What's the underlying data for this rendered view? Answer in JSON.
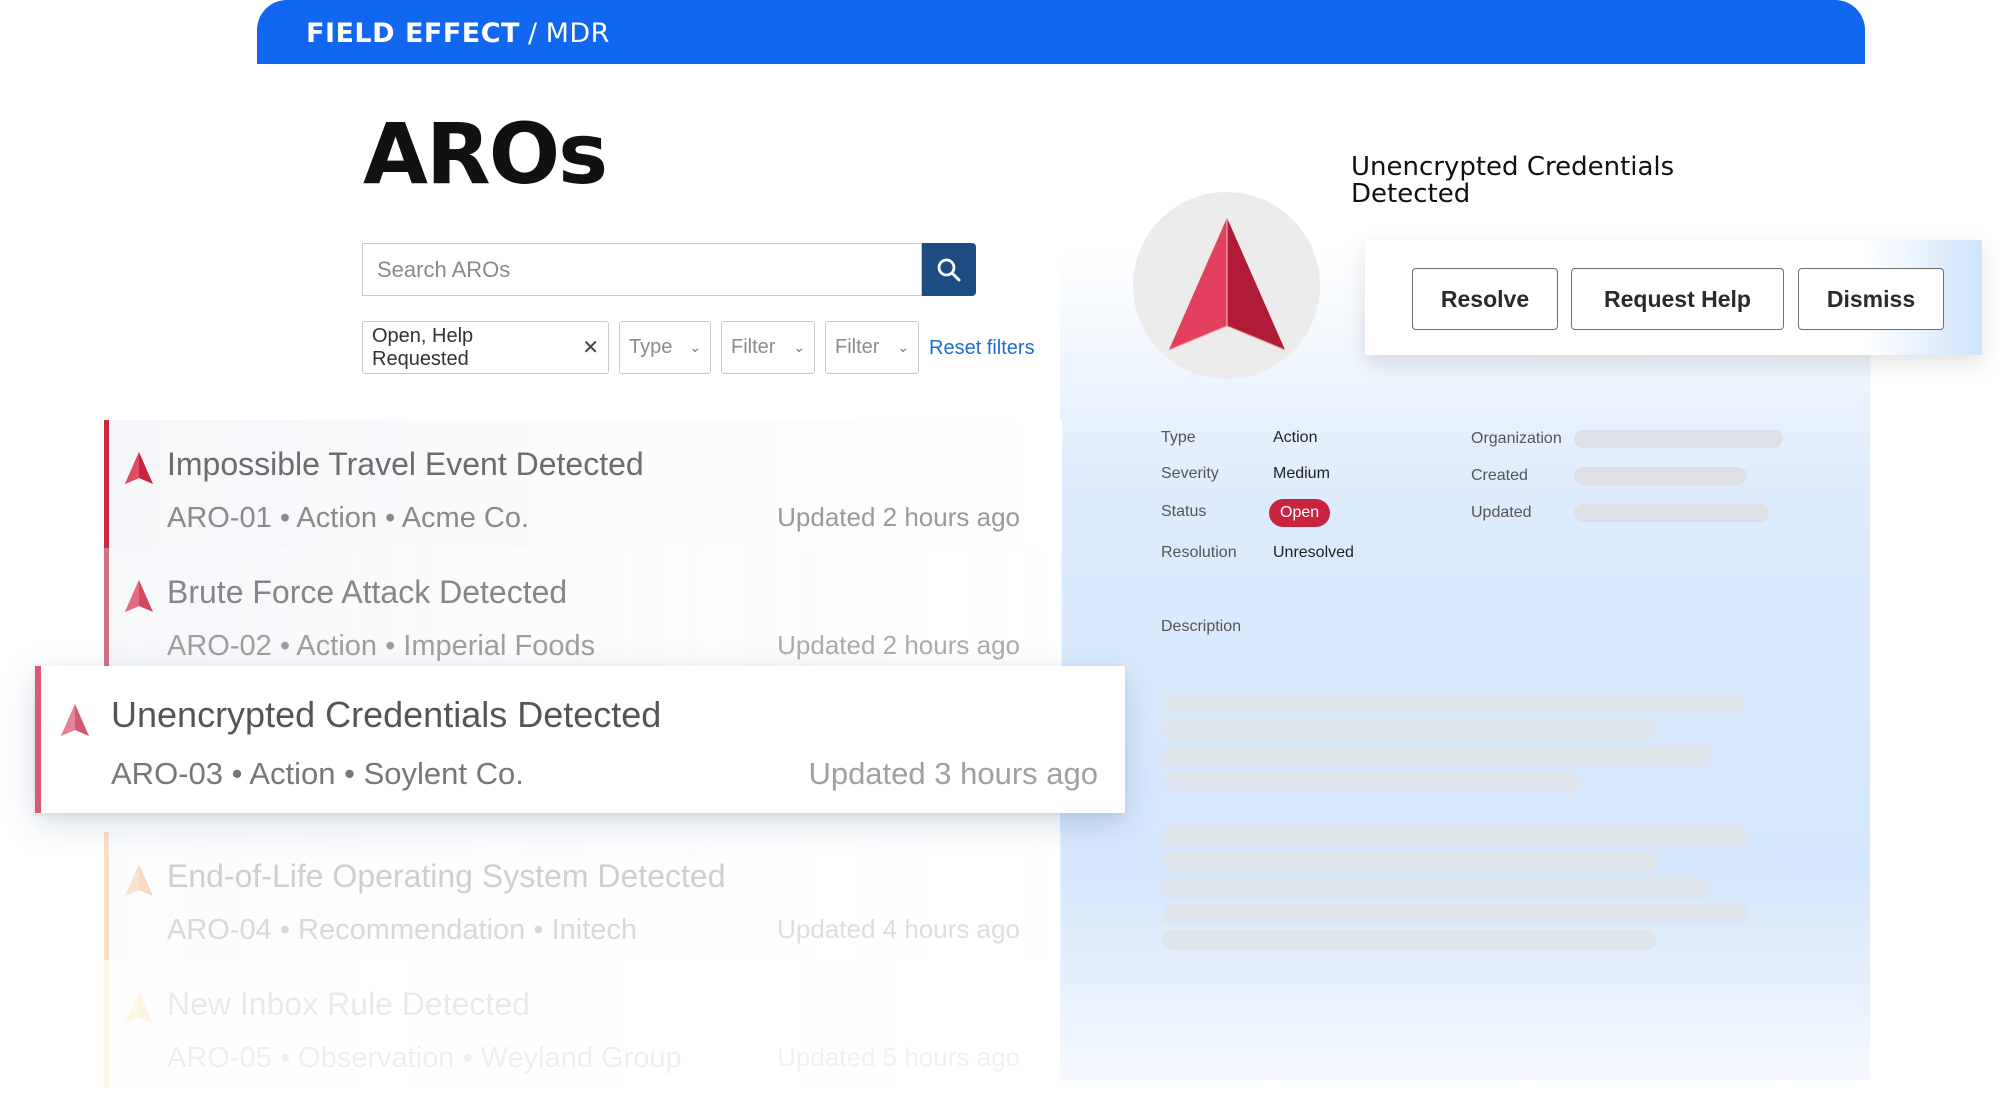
{
  "brand": {
    "name": "FIELD EFFECT",
    "separator": "/",
    "product": "MDR"
  },
  "page": {
    "title": "AROs"
  },
  "search": {
    "placeholder": "Search AROs",
    "button_icon": "search-icon"
  },
  "filters": {
    "status_chip": "Open, Help Requested",
    "status_chip_clear": "✕",
    "type_placeholder": "Type",
    "filter1_placeholder": "Filter",
    "filter2_placeholder": "Filter",
    "reset_label": "Reset filters"
  },
  "aros": [
    {
      "title": "Impossible Travel Event Detected",
      "meta": "ARO-01 • Action • Acme Co.",
      "updated": "Updated 2 hours ago"
    },
    {
      "title": "Brute Force Attack Detected",
      "meta": "ARO-02 • Action • Imperial Foods",
      "updated": "Updated 2 hours ago"
    },
    {
      "title": "Unencrypted Credentials Detected",
      "meta": "ARO-03 • Action • Soylent Co.",
      "updated": "Updated 3 hours ago"
    },
    {
      "title": "End-of-Life Operating System Detected",
      "meta": "ARO-04 • Recommendation • Initech",
      "updated": "Updated 4 hours ago"
    },
    {
      "title": "New Inbox Rule Detected",
      "meta": "ARO-05 • Observation • Weyland Group",
      "updated": "Updated 5 hours ago"
    }
  ],
  "detail": {
    "title": "Unencrypted Credentials Detected",
    "actions": {
      "resolve": "Resolve",
      "request_help": "Request Help",
      "dismiss": "Dismiss"
    },
    "fields": {
      "type_label": "Type",
      "type_value": "Action",
      "severity_label": "Severity",
      "severity_value": "Medium",
      "status_label": "Status",
      "status_value": "Open",
      "resolution_label": "Resolution",
      "resolution_value": "Unresolved",
      "organization_label": "Organization",
      "created_label": "Created",
      "updated_label": "Updated"
    },
    "description_label": "Description"
  },
  "colors": {
    "brand_blue": "#1167f0",
    "search_button": "#1d4d80",
    "status_open": "#c8233f",
    "link": "#1e6ed6"
  }
}
